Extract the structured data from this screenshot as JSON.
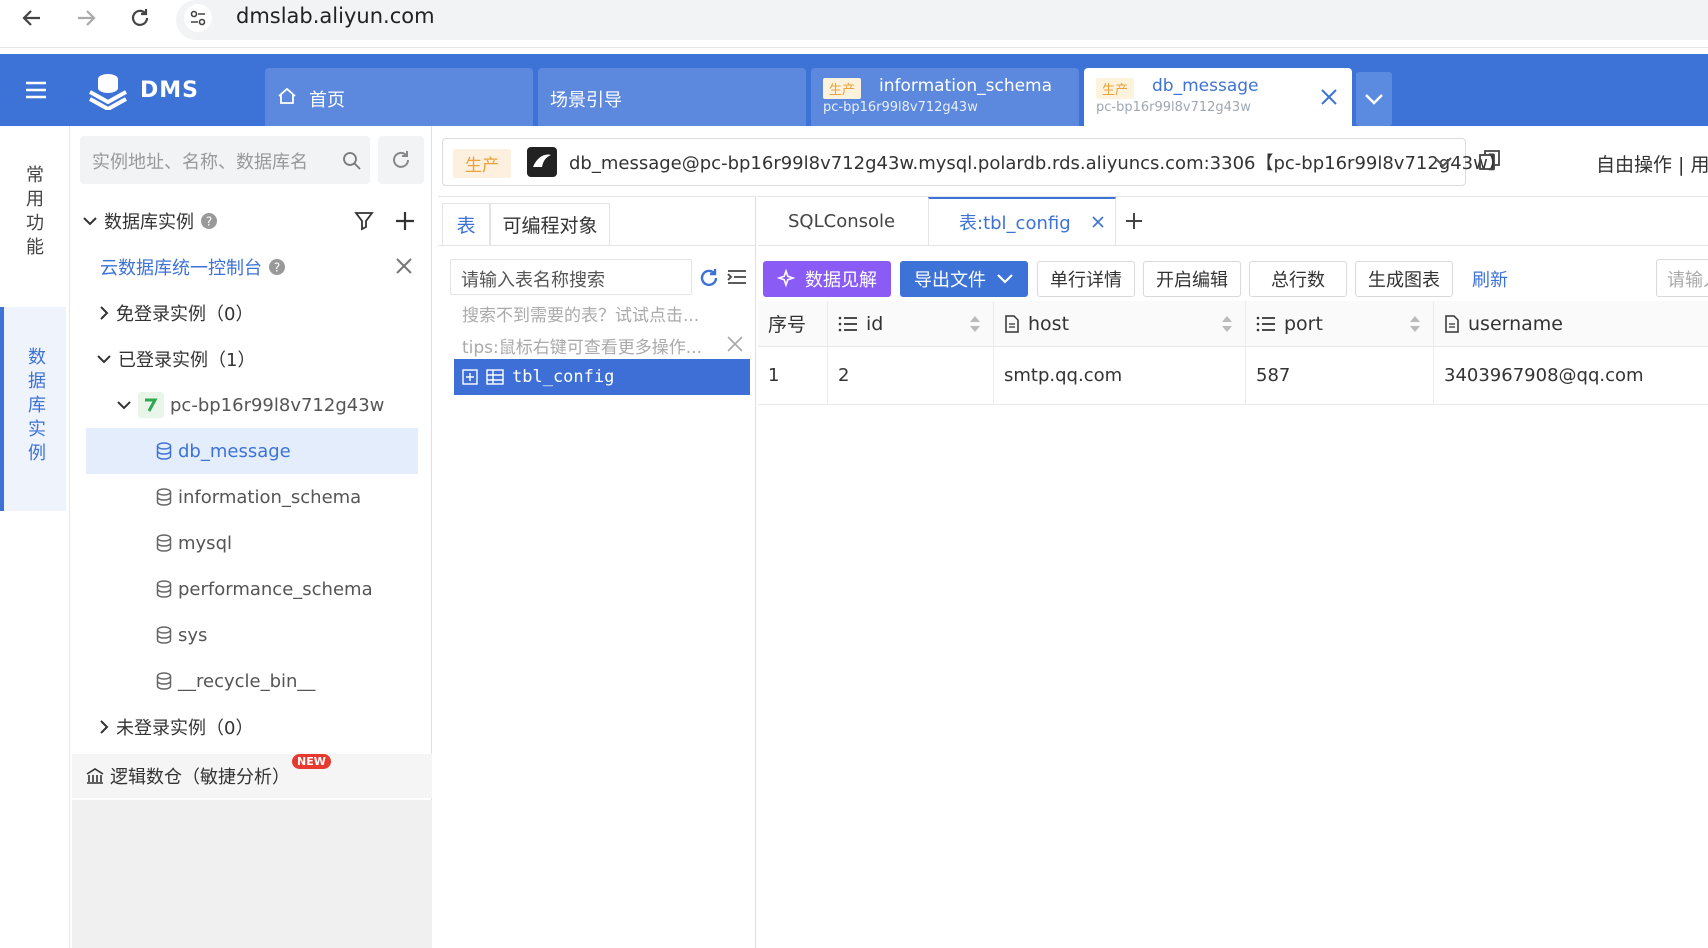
{
  "browser": {
    "url": "dmslab.aliyun.com"
  },
  "app": {
    "name": "DMS"
  },
  "header_tabs": [
    {
      "label": "首页"
    },
    {
      "label": "场景引导"
    },
    {
      "env": "生产",
      "title": "information_schema",
      "sub": "pc-bp16r99l8v712g43w"
    },
    {
      "env": "生产",
      "title": "db_message",
      "sub": "pc-bp16r99l8v712g43w"
    }
  ],
  "rail": {
    "common": "常\n用\n功\n能",
    "db_instance": "数\n据\n库\n实\n例"
  },
  "explorer": {
    "search_placeholder": "实例地址、名称、数据库名",
    "section_title": "数据库实例",
    "console_link": "云数据库统一控制台",
    "no_login_group": "免登录实例（0）",
    "logged_group": "已登录实例（1）",
    "instance": "pc-bp16r99l8v712g43w",
    "databases": [
      "db_message",
      "information_schema",
      "mysql",
      "performance_schema",
      "sys",
      "__recycle_bin__"
    ],
    "not_logged_group": "未登录实例（0）",
    "logic_dw": "逻辑数仓（敏捷分析）",
    "new_badge": "NEW"
  },
  "connection": {
    "env": "生产",
    "text": "db_message@pc-bp16r99l8v712g43w.mysql.polardb.rds.aliyuncs.com:3306【pc-bp16r99l8v712g43w】",
    "free_op": "自由操作 | 用"
  },
  "table_panel": {
    "tab_tables": "表",
    "tab_programmable": "可编程对象",
    "search_placeholder": "请输入表名称搜索",
    "hint_notfound": "搜索不到需要的表？试试点击...",
    "hint_tips": "tips:鼠标右键可查看更多操作...",
    "table_name": "tbl_config"
  },
  "result": {
    "tab_sqlconsole": "SQLConsole",
    "tab_table": "表:tbl_config",
    "buttons": {
      "insight": "数据见解",
      "export": "导出文件",
      "row_detail": "单行详情",
      "edit": "开启编辑",
      "total_rows": "总行数",
      "chart": "生成图表",
      "refresh": "刷新"
    },
    "search_placeholder": "请输入",
    "columns": [
      "序号",
      "id",
      "host",
      "port",
      "username"
    ],
    "rows": [
      [
        "1",
        "2",
        "smtp.qq.com",
        "587",
        "3403967908@qq.com"
      ]
    ]
  }
}
